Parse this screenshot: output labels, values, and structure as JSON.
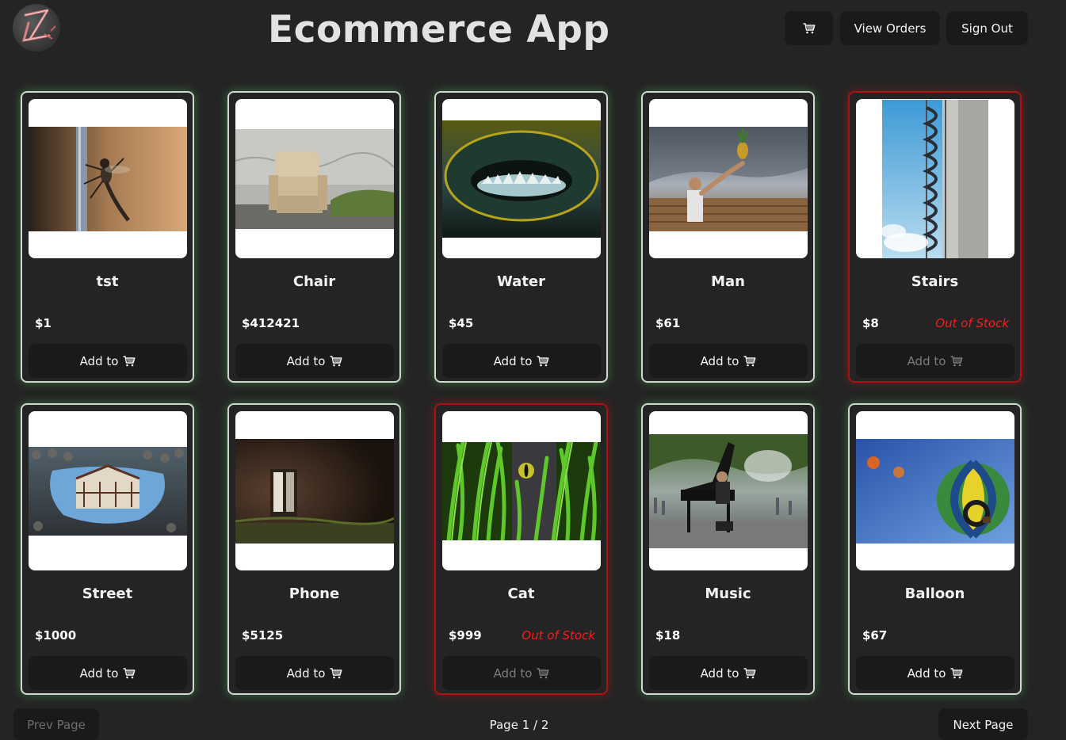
{
  "app": {
    "title": "Ecommerce App"
  },
  "header": {
    "cart_icon": "cart-icon",
    "view_orders_label": "View Orders",
    "sign_out_label": "Sign Out"
  },
  "products": [
    {
      "name": "tst",
      "price": "$1",
      "stock_label": "",
      "add_label": "Add to",
      "image": "robber-fly-on-pole",
      "in_stock": true
    },
    {
      "name": "Chair",
      "price": "$412421",
      "stock_label": "",
      "add_label": "Add to",
      "image": "old-armchair-outdoors",
      "in_stock": true
    },
    {
      "name": "Water",
      "price": "$45",
      "stock_label": "",
      "add_label": "Add to",
      "image": "water-drain-vortex",
      "in_stock": true
    },
    {
      "name": "Man",
      "price": "$61",
      "stock_label": "",
      "add_label": "Add to",
      "image": "man-holding-pineapple",
      "in_stock": true
    },
    {
      "name": "Stairs",
      "price": "$8",
      "stock_label": "Out of Stock",
      "add_label": "Add to",
      "image": "spiral-stairs-tower",
      "in_stock": false
    },
    {
      "name": "Street",
      "price": "$1000",
      "stock_label": "",
      "add_label": "Add to",
      "image": "puddle-reflection-cobblestones",
      "in_stock": true
    },
    {
      "name": "Phone",
      "price": "$5125",
      "stock_label": "",
      "add_label": "Add to",
      "image": "phone-booth-dark",
      "in_stock": true
    },
    {
      "name": "Cat",
      "price": "$999",
      "stock_label": "Out of Stock",
      "add_label": "Add to",
      "image": "cat-eye-in-grass",
      "in_stock": false
    },
    {
      "name": "Music",
      "price": "$18",
      "stock_label": "",
      "add_label": "Add to",
      "image": "pianist-in-park",
      "in_stock": true
    },
    {
      "name": "Balloon",
      "price": "$67",
      "stock_label": "",
      "add_label": "Add to",
      "image": "hot-air-balloons-sky",
      "in_stock": true
    }
  ],
  "pagination": {
    "prev_label": "Prev Page",
    "next_label": "Next Page",
    "page_info": "Page 1 / 2"
  },
  "colors": {
    "background": "#242424",
    "card_border_in_stock": "#cfd8cf",
    "card_border_out_of_stock": "#b01010",
    "out_of_stock_text": "#ff1a1a",
    "button_bg": "#1a1a1a"
  }
}
